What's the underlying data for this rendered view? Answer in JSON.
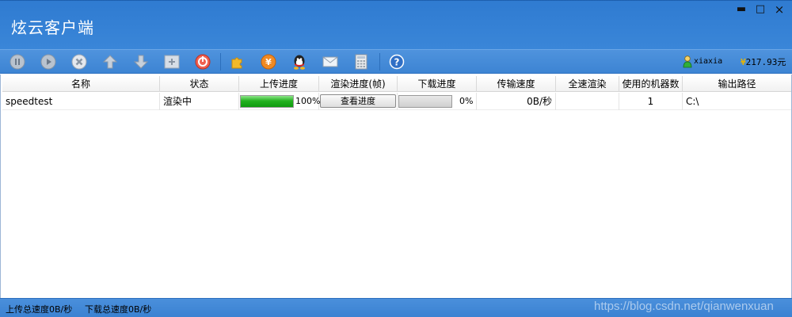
{
  "window": {
    "title": "炫云客户端",
    "min": "▬",
    "max": "□",
    "close": "×"
  },
  "toolbar": {
    "icons": [
      "pause-icon",
      "play-icon",
      "delete-icon",
      "upload-icon",
      "download-icon",
      "add-icon",
      "stop-icon",
      "plugin-icon",
      "recharge-icon",
      "qq-icon",
      "mail-icon",
      "calculator-icon",
      "help-icon"
    ],
    "user": "xiaxia",
    "balance_symbol": "¥",
    "balance": "217.93元"
  },
  "table": {
    "headers": [
      "名称",
      "状态",
      "上传进度",
      "渲染进度(帧)",
      "下载进度",
      "传输速度",
      "全速渲染",
      "使用的机器数",
      "输出路径"
    ],
    "rows": [
      {
        "name": "speedtest",
        "status": "渲染中",
        "upload_progress": 1.0,
        "upload_text": "100%",
        "render_button": "查看进度",
        "download_progress": 0.0,
        "download_text": "0%",
        "speed": "0B/秒",
        "full_speed": "",
        "machines": "1",
        "output_path": "C:\\"
      }
    ]
  },
  "status": {
    "upload_total": "上传总速度0B/秒",
    "download_total": "下载总速度0B/秒",
    "watermark": "https://blog.csdn.net/qianwenxuan"
  },
  "colors": {
    "title_bar": "#3a86d8",
    "progress_green": "#23b11f",
    "yen": "#e8b400"
  }
}
